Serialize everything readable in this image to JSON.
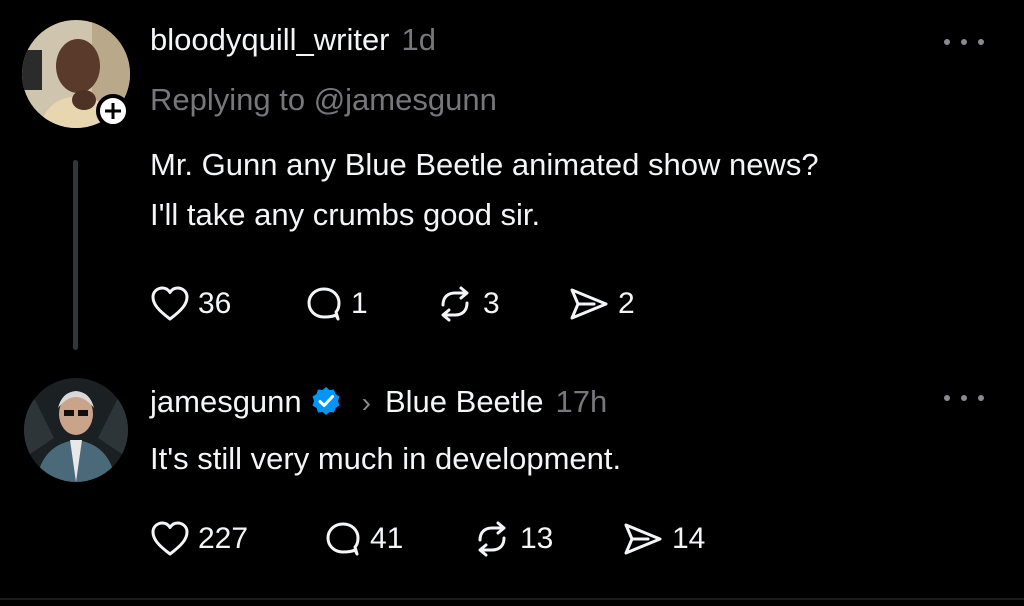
{
  "colors": {
    "background": "#000000",
    "text_primary": "#f3f5f7",
    "text_secondary": "#77777b",
    "verified_badge": "#0095f6",
    "thread_line": "#333638"
  },
  "posts": [
    {
      "username": "bloodyquill_writer",
      "time": "1d",
      "replying_to": "Replying to @jamesgunn",
      "body_lines": [
        "Mr. Gunn any Blue Beetle animated show news?",
        "I'll take any crumbs good sir."
      ],
      "has_follow_badge": true,
      "actions": {
        "likes": "36",
        "replies": "1",
        "reposts": "3",
        "shares": "2"
      }
    },
    {
      "username": "jamesgunn",
      "verified": true,
      "chevron": "›",
      "tag": "Blue Beetle",
      "time": "17h",
      "body_lines": [
        "It's still very much in development."
      ],
      "actions": {
        "likes": "227",
        "replies": "41",
        "reposts": "13",
        "shares": "14"
      }
    }
  ],
  "icons": {
    "like": "heart-icon",
    "reply": "comment-icon",
    "repost": "repost-icon",
    "share": "send-icon",
    "more": "more-options-icon",
    "follow": "plus-icon",
    "verified": "verified-badge-icon"
  }
}
